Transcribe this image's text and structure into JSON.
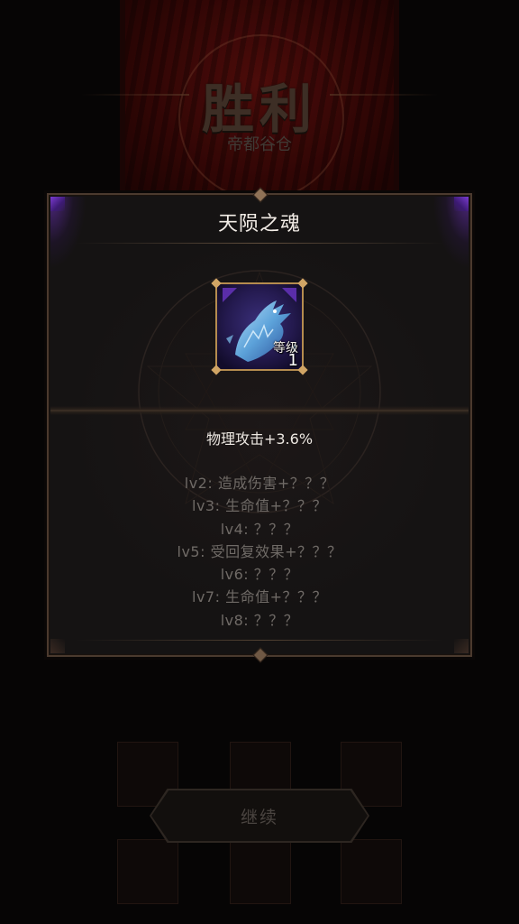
{
  "background": {
    "victory_title": "胜利",
    "location": "帝都谷仓",
    "continue_label": "继续"
  },
  "modal": {
    "title": "天陨之魂",
    "item": {
      "icon": "ice-dragon-soul-icon",
      "rarity_color": "#6a35c4",
      "level_label": "等级",
      "level_value": "1"
    },
    "main_effect": "物理攻击+3.6%",
    "locked_effects": [
      "lv2: 造成伤害+？？？",
      "lv3: 生命值+？？？",
      "lv4: ？？？",
      "lv5: 受回复效果+？？？",
      "lv6: ？？？",
      "lv7: 生命值+？？？",
      "lv8: ？？？"
    ]
  }
}
